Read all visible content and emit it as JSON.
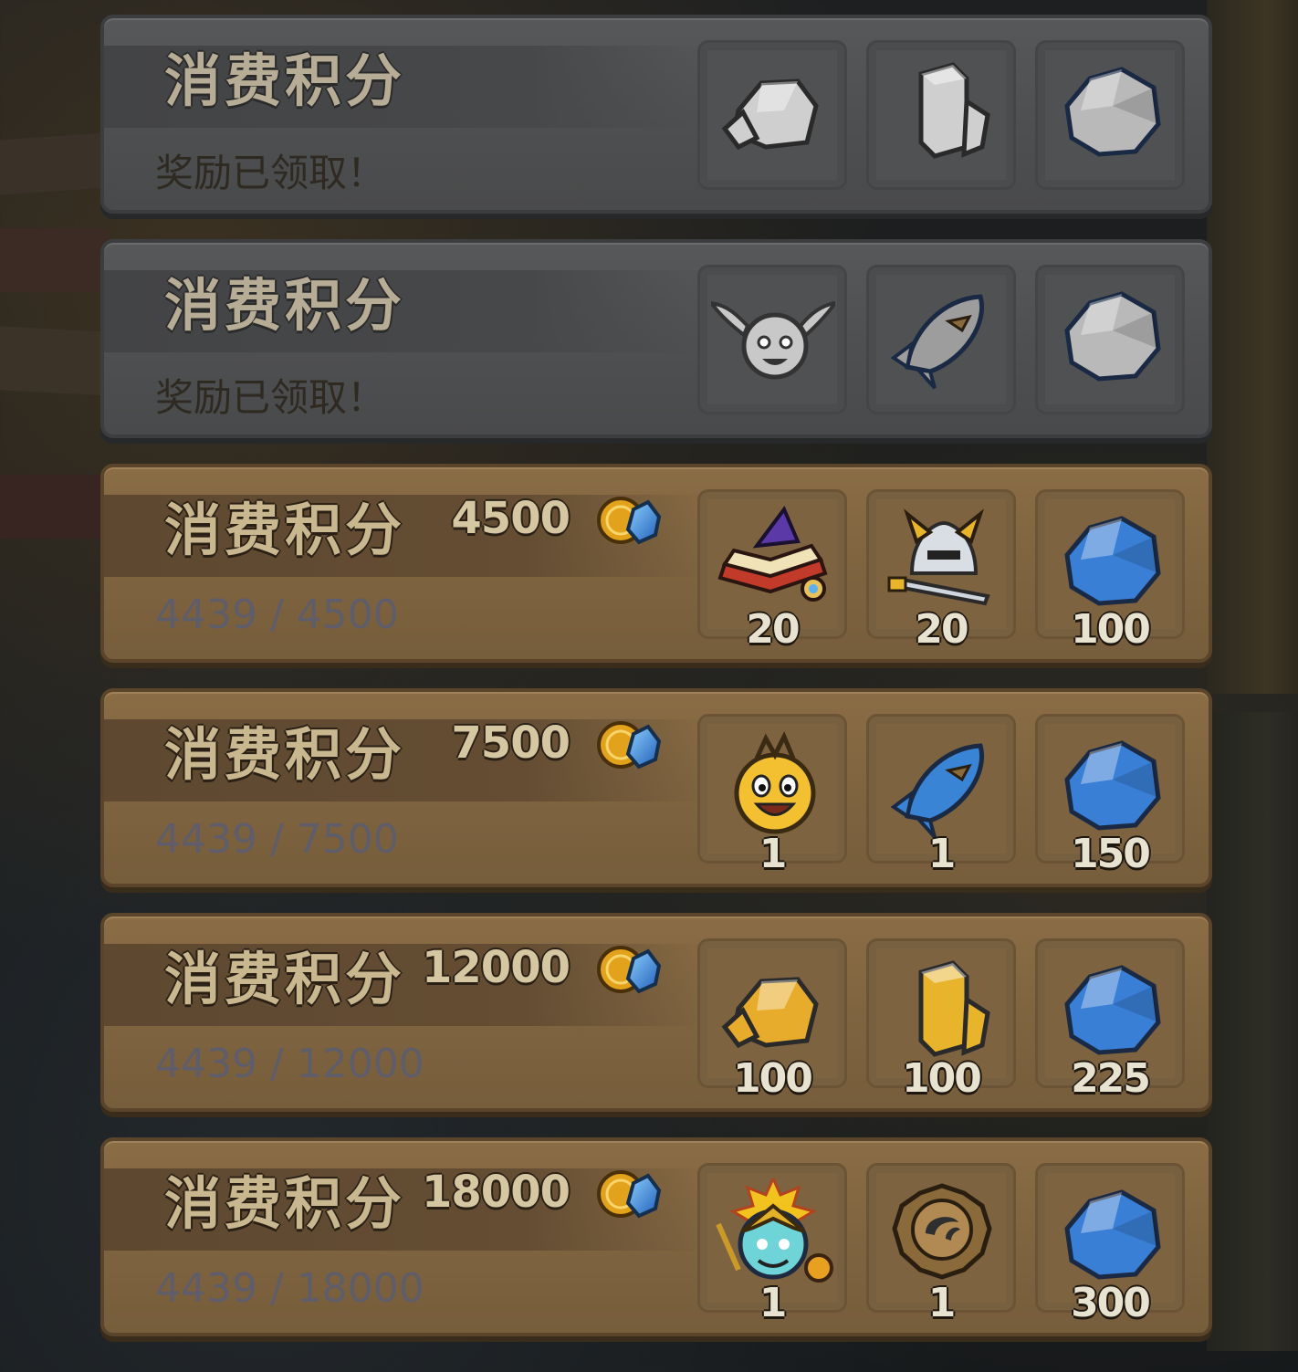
{
  "colors": {
    "claimed_panel": "#4f5051",
    "active_panel": "#7f6440",
    "title_text": "#c9b78f",
    "progress_text": "#5f5d6a",
    "gem_blue": "#3a7fd6",
    "gold": "#e0a62a"
  },
  "tiers": [
    {
      "title": "消费积分",
      "status": "奖励已领取！",
      "rewards": [
        {
          "icon": "gray-ore-icon"
        },
        {
          "icon": "gray-crystal-pillar-icon"
        },
        {
          "icon": "gray-gem-icon"
        }
      ]
    },
    {
      "title": "消费积分",
      "status": "奖励已领取！",
      "rewards": [
        {
          "icon": "gray-winged-hero-icon"
        },
        {
          "icon": "gray-rocket-icon"
        },
        {
          "icon": "gray-gem-icon"
        }
      ]
    },
    {
      "title": "消费积分",
      "cost": "4500",
      "progress": "4439 / 4500",
      "rewards": [
        {
          "icon": "wizard-hat-spellbook-icon",
          "qty": "20"
        },
        {
          "icon": "golden-helmet-sword-icon",
          "qty": "20"
        },
        {
          "icon": "blue-gem-icon",
          "qty": "100"
        }
      ]
    },
    {
      "title": "消费积分",
      "cost": "7500",
      "progress": "4439 / 7500",
      "rewards": [
        {
          "icon": "yellow-lantern-hero-icon",
          "qty": "1"
        },
        {
          "icon": "blue-rocket-icon",
          "qty": "1"
        },
        {
          "icon": "blue-gem-icon",
          "qty": "150"
        }
      ]
    },
    {
      "title": "消费积分",
      "cost": "12000",
      "progress": "4439 / 12000",
      "rewards": [
        {
          "icon": "gold-ore-icon",
          "qty": "100"
        },
        {
          "icon": "gold-crystal-pillar-icon",
          "qty": "100"
        },
        {
          "icon": "blue-gem-icon",
          "qty": "225"
        }
      ]
    },
    {
      "title": "消费积分",
      "cost": "18000",
      "progress": "4439 / 18000",
      "rewards": [
        {
          "icon": "golden-knight-hero-icon",
          "qty": "1"
        },
        {
          "icon": "bronze-emblem-icon",
          "qty": "1"
        },
        {
          "icon": "blue-gem-icon",
          "qty": "300"
        }
      ]
    }
  ]
}
